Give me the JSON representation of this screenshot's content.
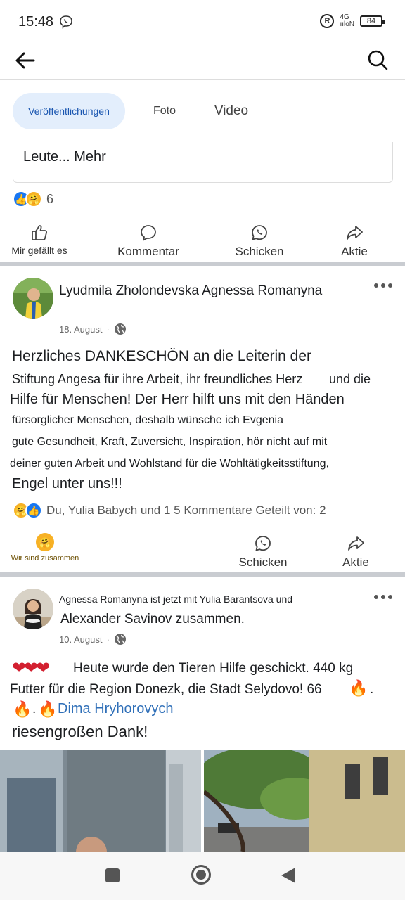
{
  "status": {
    "time": "15:48",
    "network": "4G",
    "signal": "ııloN",
    "battery": "84"
  },
  "tabs": [
    {
      "label": "Veröffentlichungen",
      "active": true
    },
    {
      "label": "Foto",
      "active": false
    },
    {
      "label": "Video",
      "active": false
    }
  ],
  "prev_post": {
    "text": "Leute... Mehr",
    "reaction_count": "6",
    "actions": {
      "like": "Mir gefällt es",
      "comment": "Kommentar",
      "send": "Schicken",
      "share": "Aktie"
    }
  },
  "post1": {
    "author": "Lyudmila Zholondevska Agnessa Romanyna",
    "date": "18. August",
    "lines": [
      "Herzliches DANKESCHÖN an die Leiterin der",
      "Stiftung Angesa für ihre Arbeit, ihr freundliches Herz",
      "und die",
      "Hilfe für Menschen! Der Herr hilft uns mit den Händen",
      "fürsorglicher Menschen, deshalb wünsche ich Evgenia",
      "gute Gesundheit, Kraft, Zuversicht, Inspiration, hör nicht auf mit",
      "deiner guten Arbeit und Wohlstand für die Wohltätigkeitsstiftung,",
      "Engel unter uns!!!"
    ],
    "reactions_summary": "Du, Yulia Babych und 1 5 Kommentare Geteilt von: 2",
    "actions": {
      "react": "Wir sind zusammen",
      "send": "Schicken",
      "share": "Aktie"
    }
  },
  "post2": {
    "header_line1": "Agnessa Romanyna ist jetzt mit Yulia Barantsova und",
    "header_line2": "Alexander Savinov zusammen.",
    "date": "10. August",
    "line1": "Heute wurde den Tieren Hilfe geschickt. 440 kg",
    "line2": "Futter für die Region Donezk, die Stadt Selydovo! 66",
    "line2_end": ".",
    "line3_dot": ".",
    "mention": "Dima Hryhorovych",
    "line4": "riesengroßen Dank!"
  },
  "colors": {
    "accent": "#1877f2",
    "tab_active_bg": "#e3eefc",
    "mention": "#2f6fb8"
  }
}
